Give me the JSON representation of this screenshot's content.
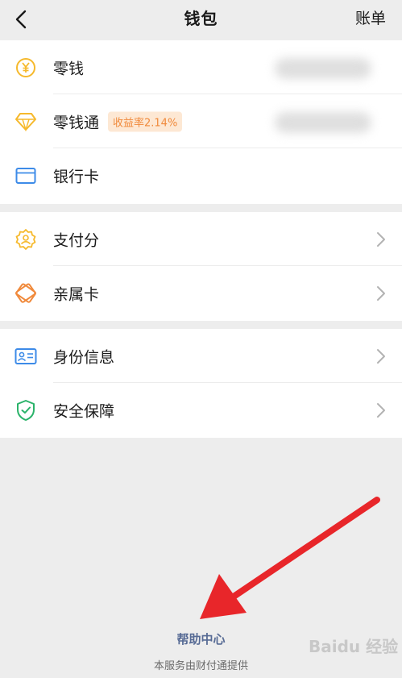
{
  "header": {
    "title": "钱包",
    "bill_label": "账单"
  },
  "group1": {
    "items": [
      {
        "label": "零钱",
        "icon": "yen-coin-icon"
      },
      {
        "label": "零钱通",
        "icon": "diamond-icon",
        "badge": "收益率2.14%"
      },
      {
        "label": "银行卡",
        "icon": "bank-card-icon"
      }
    ]
  },
  "group2": {
    "items": [
      {
        "label": "支付分",
        "icon": "badge-icon"
      },
      {
        "label": "亲属卡",
        "icon": "family-card-icon"
      }
    ]
  },
  "group3": {
    "items": [
      {
        "label": "身份信息",
        "icon": "id-card-icon"
      },
      {
        "label": "安全保障",
        "icon": "shield-icon"
      }
    ]
  },
  "footer": {
    "help_label": "帮助中心",
    "note": "本服务由财付通提供"
  },
  "watermark": "Baidu 经验",
  "colors": {
    "accent_link": "#576b95",
    "annotation_arrow": "#e8262a"
  }
}
